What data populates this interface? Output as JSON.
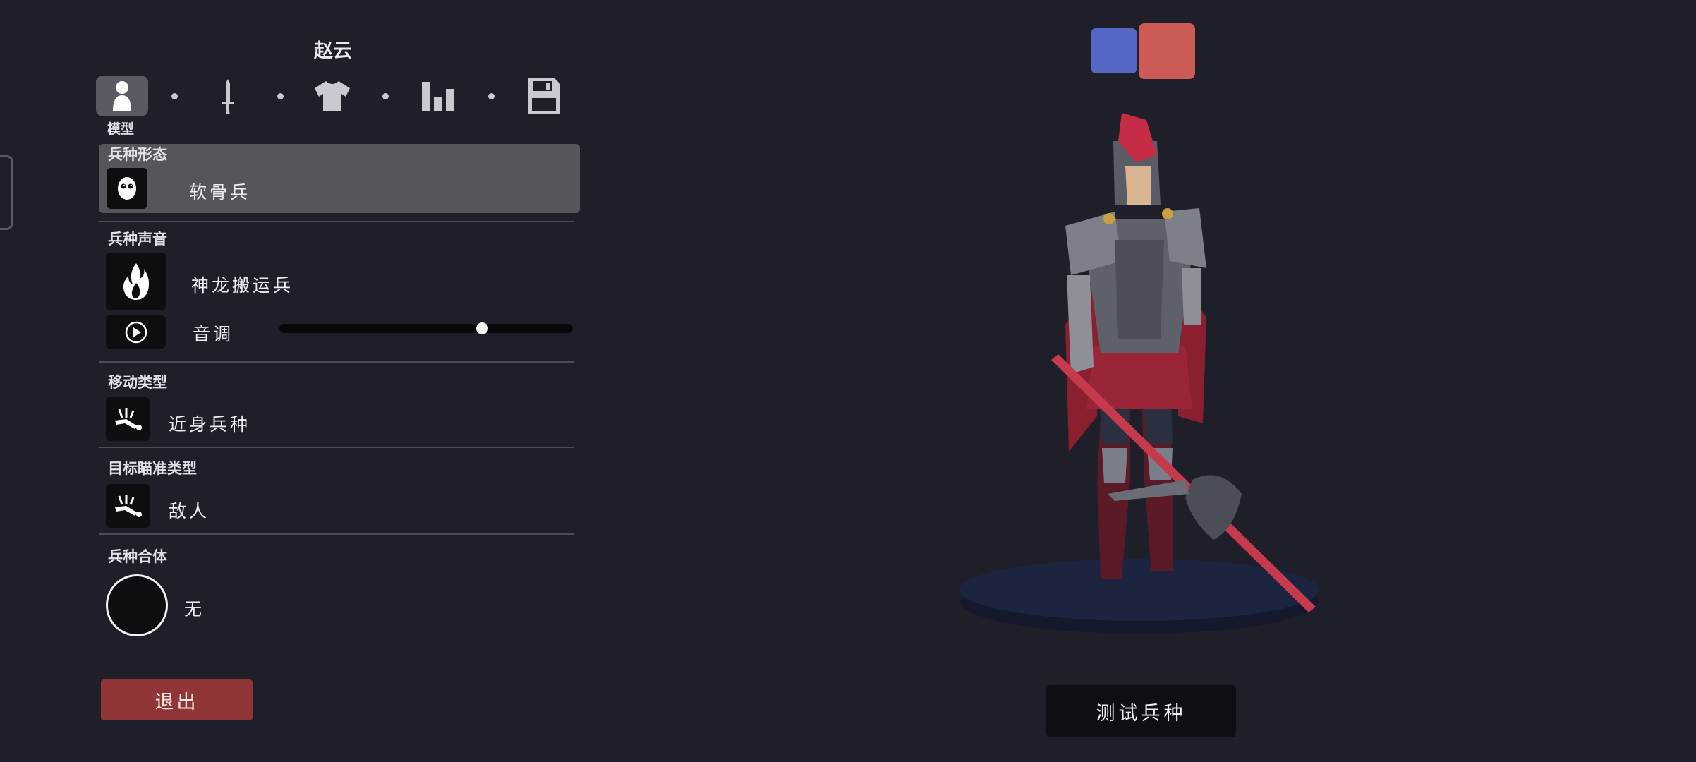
{
  "header": {
    "unit_name": "赵云"
  },
  "tabs": [
    {
      "id": "model",
      "icon": "person-icon",
      "label": "模型",
      "active": true
    },
    {
      "id": "weapon",
      "icon": "sword-icon",
      "active": false
    },
    {
      "id": "clothing",
      "icon": "shirt-icon",
      "active": false
    },
    {
      "id": "stats",
      "icon": "bar-chart-icon",
      "active": false
    },
    {
      "id": "save",
      "icon": "save-icon",
      "active": false
    }
  ],
  "sections": {
    "form": {
      "label": "兵种形态",
      "value": "软骨兵",
      "icon": "ghost-face-icon"
    },
    "voice": {
      "label": "兵种声音",
      "value": "神龙搬运兵",
      "icon": "fire-icon",
      "pitch_label": "音调",
      "pitch_value": 0.69,
      "play_icon": "play-icon"
    },
    "movement": {
      "label": "移动类型",
      "value": "近身兵种",
      "icon": "melee-icon"
    },
    "targeting": {
      "label": "目标瞄准类型",
      "value": "敌人",
      "icon": "target-enemy-icon"
    },
    "combine": {
      "label": "兵种合体",
      "value": "无",
      "icon": "empty-circle-icon"
    }
  },
  "buttons": {
    "exit": "退出",
    "test": "测试兵种"
  },
  "team_colors": {
    "blue": "#5566c4",
    "red": "#cc5a55",
    "selected": "red"
  },
  "colors": {
    "background": "#1f1f29",
    "panel_highlight": "#55555c",
    "exit_button": "#8f3535"
  }
}
